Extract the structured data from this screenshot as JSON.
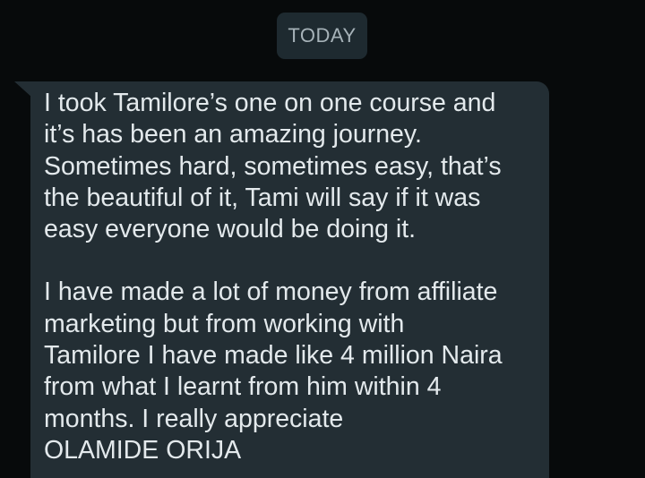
{
  "date_chip": {
    "label": "TODAY"
  },
  "message": {
    "paragraph_1": "I took Tamilore’s one on one course and\nit’s has been an amazing journey.\nSometimes hard, sometimes easy, that’s\nthe beautiful of it, Tami will say if it was\neasy everyone would be doing it.",
    "paragraph_2": "I have made a lot of money from affiliate\nmarketing but from working with\nTamilore  I have made like 4 million Naira\nfrom what I learnt from him within 4\nmonths. I really appreciate\nOLAMIDE ORIJA"
  },
  "colors": {
    "background": "#070a0b",
    "bubble": "#232e34",
    "chip": "#1e2a30",
    "text": "#e3e9ec",
    "chip_text": "#a6b2b8"
  }
}
